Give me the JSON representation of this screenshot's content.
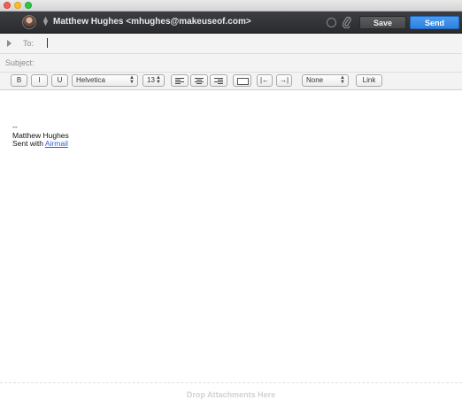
{
  "account": {
    "name": "Matthew Hughes <mhughes@makeuseof.com>",
    "switch_glyph": "⬍",
    "avatar_icon": "avatar-photo",
    "options_icon": "circle-icon",
    "attach_icon": "paperclip-icon"
  },
  "actions": {
    "save_label": "Save",
    "send_label": "Send",
    "send_color": "#2f80de"
  },
  "fields": {
    "to_label": "To:",
    "to_value": "",
    "subject_label": "Subject:",
    "subject_value": ""
  },
  "format": {
    "bold_label": "B",
    "italic_label": "I",
    "underline_label": "U",
    "font_family": "Helvetica",
    "font_size": "13",
    "list_style": "None",
    "link_label": "Link",
    "outdent_glyph": "|←",
    "indent_glyph": "→|"
  },
  "message": {
    "separator": "--",
    "sender": "Matthew Hughes",
    "sent_with": "Sent with",
    "app_link": "Airmail"
  },
  "attachments": {
    "drop_label": "Drop Attachments Here"
  }
}
